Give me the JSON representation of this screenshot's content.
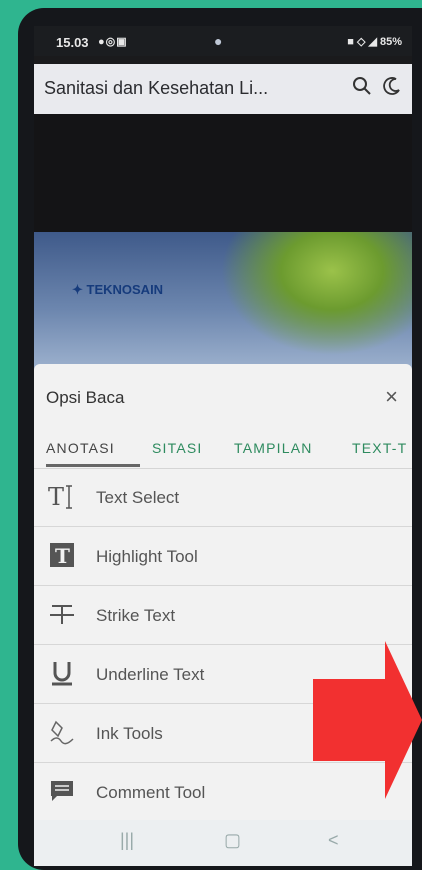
{
  "status": {
    "time": "15.03",
    "left_icons": "●◎▣",
    "right": "■ ◇ ◢ 85%"
  },
  "appbar": {
    "title": "Sanitasi dan Kesehatan Li...",
    "search_icon": "search-icon",
    "theme_icon": "moon-icon"
  },
  "cover": {
    "brand": "TEKNOSAIN"
  },
  "sheet": {
    "title": "Opsi Baca",
    "close": "×",
    "tabs": [
      {
        "label": "ANOTASI"
      },
      {
        "label": "SITASI"
      },
      {
        "label": "TAMPILAN"
      },
      {
        "label": "TEXT-T"
      }
    ],
    "tools": [
      {
        "label": "Text Select",
        "icon": "text-select-icon"
      },
      {
        "label": "Highlight Tool",
        "icon": "highlight-icon"
      },
      {
        "label": "Strike Text",
        "icon": "strikethrough-icon"
      },
      {
        "label": "Underline Text",
        "icon": "underline-icon"
      },
      {
        "label": "Ink Tools",
        "icon": "ink-pen-icon"
      },
      {
        "label": "Comment Tool",
        "icon": "comment-icon"
      }
    ]
  },
  "nav": {
    "recents": "|||",
    "home": "▢",
    "back": "<"
  },
  "colors": {
    "accent": "#2e8b5f",
    "arrow": "#f23030",
    "background": "#2fb58f"
  }
}
